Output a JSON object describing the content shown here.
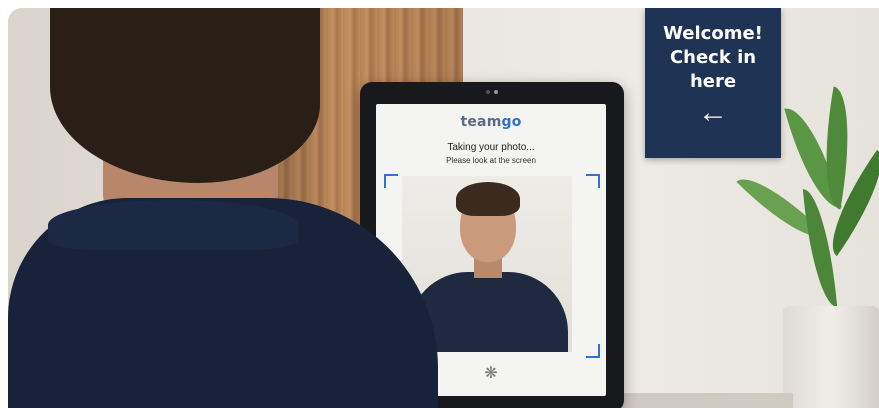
{
  "scene": {
    "sign": {
      "lines": [
        "Welcome!",
        "Check in",
        "here"
      ],
      "arrow_icon": "arrow-left-icon"
    },
    "kiosk": {
      "brand_part1": "team",
      "brand_part2": "go",
      "status_title": "Taking your photo...",
      "status_subtitle": "Please look at the screen",
      "spinner_icon": "loading-spinner-icon"
    },
    "colors": {
      "sign_bg": "#1f3354",
      "brand_accent": "#2f6fd6",
      "shirt": "#1f2a40"
    }
  }
}
